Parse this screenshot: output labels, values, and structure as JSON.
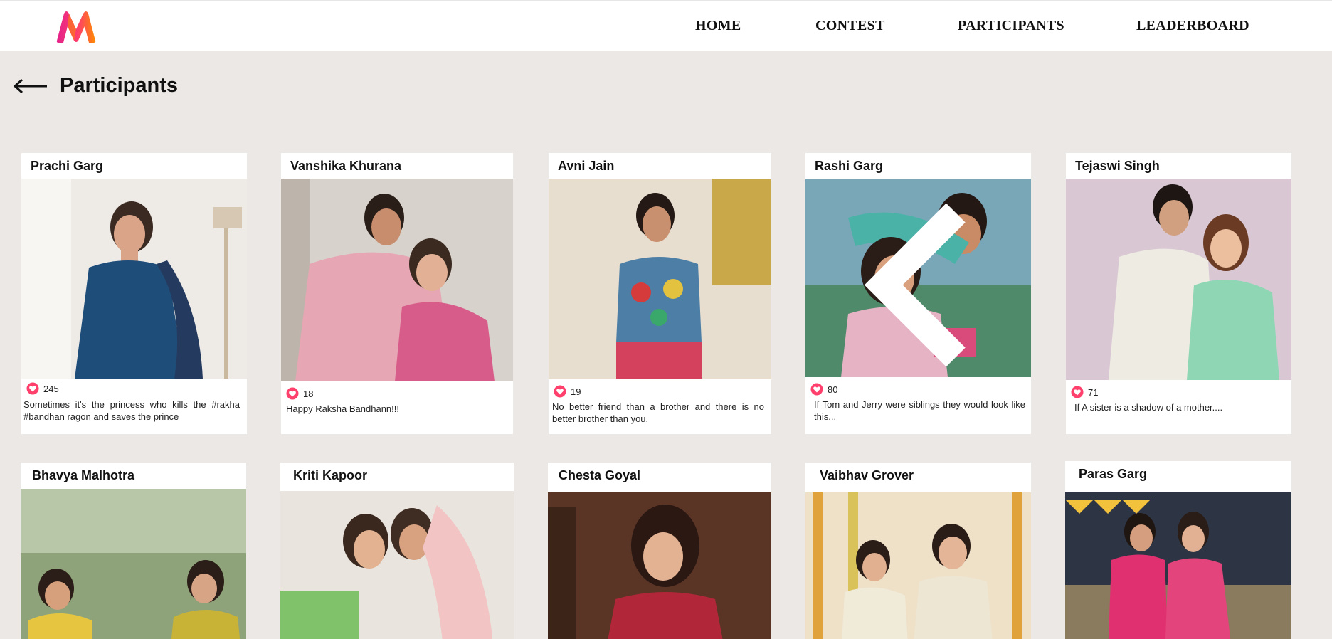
{
  "brand": {
    "logo_icon": "myntra-m-logo",
    "colors": {
      "pink": "#ff3f6c",
      "orange": "#ff8a00",
      "magenta": "#e3218b",
      "heart": "#ff3f6c"
    }
  },
  "nav": {
    "items": [
      "HOME",
      "CONTEST",
      "PARTICIPANTS",
      "LEADERBOARD"
    ]
  },
  "page": {
    "title": "Participants",
    "back_icon": "arrow-left-icon"
  },
  "participants": [
    {
      "name": "Prachi Garg",
      "likes": "245",
      "caption": "Sometimes it's the princess who kills the #rakha #bandhan ragon and saves the prince"
    },
    {
      "name": "Vanshika Khurana",
      "likes": "18",
      "caption": "Happy Raksha Bandhann!!!"
    },
    {
      "name": "Avni Jain",
      "likes": "19",
      "caption": "No better friend than a brother and there is no better brother than you."
    },
    {
      "name": "Rashi Garg",
      "likes": "80",
      "caption": "If Tom and Jerry were siblings they would look like this..."
    },
    {
      "name": "Tejaswi Singh",
      "likes": "71",
      "caption": "If A sister is a shadow of a mother...."
    },
    {
      "name": "Bhavya Malhotra"
    },
    {
      "name": "Kriti Kapoor"
    },
    {
      "name": "Chesta Goyal"
    },
    {
      "name": "Vaibhav Grover"
    },
    {
      "name": "Paras Garg"
    }
  ]
}
